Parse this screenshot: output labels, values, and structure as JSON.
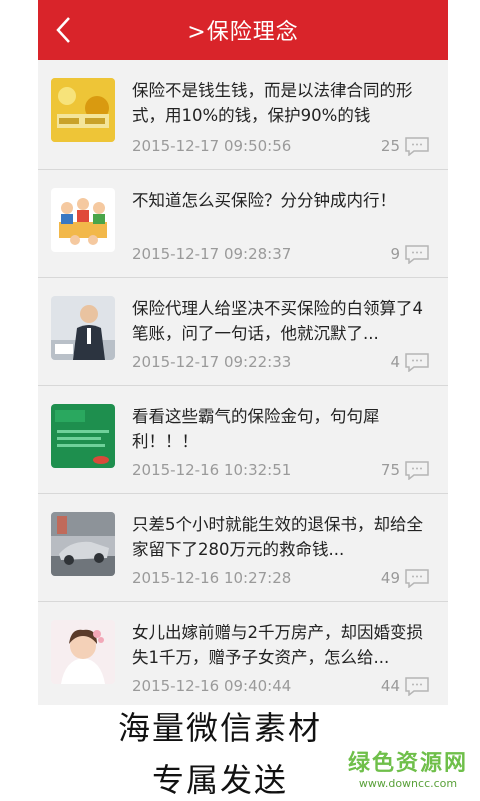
{
  "header": {
    "title": ">保险理念"
  },
  "articles": [
    {
      "title": "保险不是钱生钱，而是以法律合同的形式，用10%的钱，保护90%的钱",
      "date": "2015-12-17 09:50:56",
      "comments": "25",
      "thumb": "gold-coins"
    },
    {
      "title": "不知道怎么买保险？分分钟成内行！",
      "date": "2015-12-17 09:28:37",
      "comments": "9",
      "thumb": "meeting"
    },
    {
      "title": "保险代理人给坚决不买保险的白领算了4笔账，问了一句话，他就沉默了...",
      "date": "2015-12-17 09:22:33",
      "comments": "4",
      "thumb": "office-man"
    },
    {
      "title": "看看这些霸气的保险金句，句句犀利！！！",
      "date": "2015-12-16 10:32:51",
      "comments": "75",
      "thumb": "green-sign"
    },
    {
      "title": "只差5个小时就能生效的退保书，却给全家留下了280万元的救命钱...",
      "date": "2015-12-16 10:27:28",
      "comments": "49",
      "thumb": "car-crash"
    },
    {
      "title": "女儿出嫁前赠与2千万房产，却因婚变损失1千万，赠予子女资产，怎么给...",
      "date": "2015-12-16 09:40:44",
      "comments": "44",
      "thumb": "bride"
    }
  ],
  "caption": {
    "line1": "海量微信素材",
    "line2": "专属发送"
  },
  "watermark": {
    "line1": "绿色资源网",
    "line2": "www.downcc.com"
  },
  "colors": {
    "accent": "#d9242a",
    "watermark": "#6fbf4a"
  }
}
